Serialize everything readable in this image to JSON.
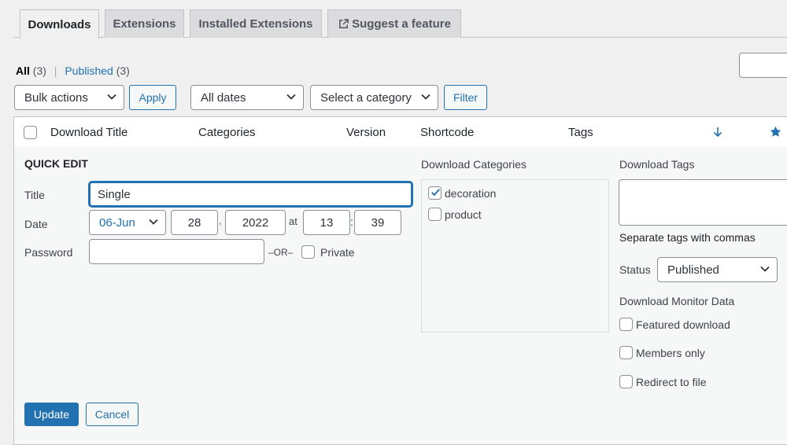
{
  "tabs": [
    {
      "label": "Downloads"
    },
    {
      "label": "Extensions"
    },
    {
      "label": "Installed Extensions"
    },
    {
      "label": "Suggest a feature"
    }
  ],
  "filters": {
    "all_label": "All",
    "all_count": "(3)",
    "separator": "|",
    "published_label": "Published",
    "published_count": "(3)"
  },
  "toolbar": {
    "bulk_actions": "Bulk actions",
    "apply": "Apply",
    "dates": "All dates",
    "category": "Select a category",
    "filter": "Filter"
  },
  "columns": {
    "title": "Download Title",
    "categories": "Categories",
    "version": "Version",
    "shortcode": "Shortcode",
    "tags": "Tags"
  },
  "quick_edit": {
    "heading": "QUICK EDIT",
    "title_label": "Title",
    "title_value": "Single",
    "date_label": "Date",
    "month": "06-Jun",
    "day": "28",
    "comma": ",",
    "year": "2022",
    "at": "at",
    "hour": "13",
    "colon": ":",
    "minute": "39",
    "password_label": "Password",
    "password_value": "",
    "or": "–OR–",
    "private_label": "Private",
    "categories_heading": "Download Categories",
    "categories": [
      {
        "label": "decoration",
        "checked": true
      },
      {
        "label": "product",
        "checked": false
      }
    ],
    "tags_heading": "Download Tags",
    "tags_value": "",
    "tags_hint": "Separate tags with commas",
    "status_label": "Status",
    "status_value": "Published",
    "monitor_heading": "Download Monitor Data",
    "options": [
      {
        "label": "Featured download",
        "checked": false
      },
      {
        "label": "Members only",
        "checked": false
      },
      {
        "label": "Redirect to file",
        "checked": false
      }
    ],
    "update": "Update",
    "cancel": "Cancel"
  },
  "colors": {
    "accent": "#2271b1",
    "background": "#f0f0f1",
    "panel": "#f6f7f7",
    "border": "#c3c4c7"
  },
  "icons": {
    "external": "external-link-icon",
    "sort": "arrow-down-icon",
    "featured": "star-icon",
    "dropdown": "chevron-down-icon",
    "check": "checkmark-icon"
  }
}
